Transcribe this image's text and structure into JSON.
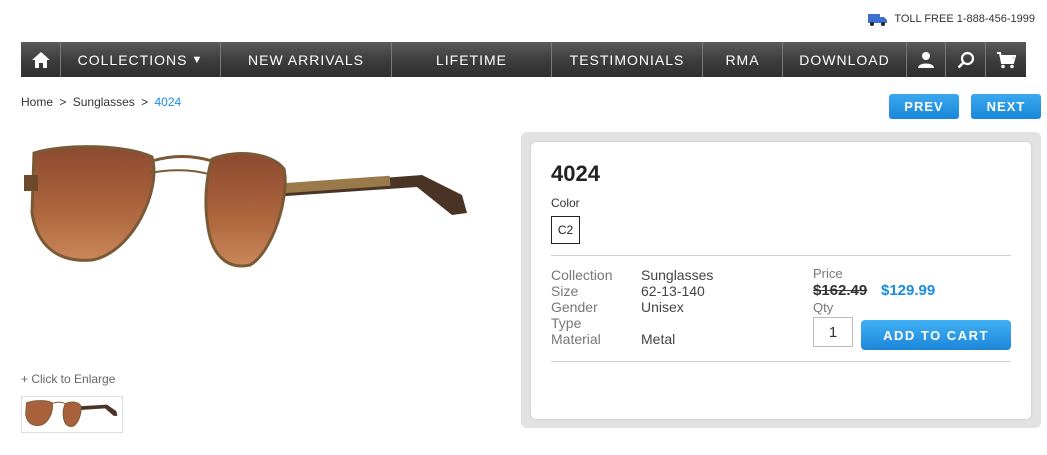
{
  "header": {
    "toll_free": "TOLL FREE 1-888-456-1999",
    "icon": "truck-icon"
  },
  "nav": {
    "home_icon": "home-icon",
    "items": [
      {
        "label": "COLLECTIONS",
        "dropdown": true
      },
      {
        "label": "NEW ARRIVALS"
      },
      {
        "label": "LIFETIME"
      },
      {
        "label": "TESTIMONIALS"
      },
      {
        "label": "RMA"
      },
      {
        "label": "DOWNLOAD"
      }
    ],
    "account_icon": "user-icon",
    "search_icon": "search-icon",
    "cart_icon": "cart-icon"
  },
  "breadcrumb": {
    "home": "Home",
    "category": "Sunglasses",
    "current": "4024",
    "separator": ">"
  },
  "pager": {
    "prev": "PREV",
    "next": "NEXT"
  },
  "gallery": {
    "enlarge": "+ Click to Enlarge"
  },
  "product": {
    "title": "4024",
    "color_label": "Color",
    "color_option": "C2",
    "specs": [
      {
        "label": "Collection",
        "value": "Sunglasses"
      },
      {
        "label": "Size",
        "value": "62-13-140"
      },
      {
        "label": "Gender",
        "value": "Unisex"
      },
      {
        "label": "Type",
        "value": ""
      },
      {
        "label": "Material",
        "value": "Metal"
      }
    ],
    "price_label": "Price",
    "old_price": "$162.49",
    "new_price": "$129.99",
    "qty_label": "Qty",
    "qty_value": "1",
    "add_to_cart": "ADD TO CART"
  },
  "colors": {
    "accent": "#1a8be0",
    "nav_bg": "#3c3c3c",
    "lens": "#a05a3a",
    "frame": "#8a6a40"
  }
}
